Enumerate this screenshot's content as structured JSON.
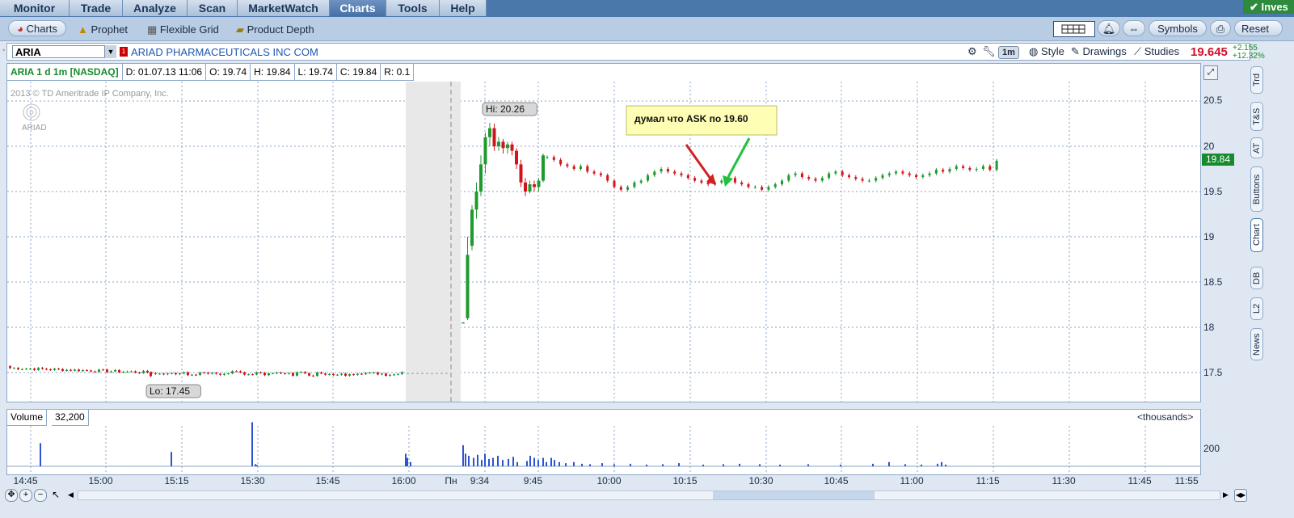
{
  "top_tabs": [
    {
      "label": "Monitor"
    },
    {
      "label": "Trade"
    },
    {
      "label": "Analyze"
    },
    {
      "label": "Scan"
    },
    {
      "label": "MarketWatch"
    },
    {
      "label": "Charts"
    },
    {
      "label": "Tools"
    },
    {
      "label": "Help"
    }
  ],
  "active_tab": "Charts",
  "invest_button": "Inves",
  "sub_toolbar": {
    "items": [
      {
        "label": "Charts",
        "icon": "charts-icon"
      },
      {
        "label": "Prophet",
        "icon": "prophet-icon"
      },
      {
        "label": "Flexible Grid",
        "icon": "grid-icon"
      },
      {
        "label": "Product Depth",
        "icon": "depth-icon"
      }
    ],
    "symbols_label": "Symbols",
    "reset_label": "Reset"
  },
  "symbol_bar": {
    "symbol": "ARIA",
    "flag": "1",
    "company_name": "ARIAD PHARMACEUTICALS INC COM",
    "aggregation": "1m",
    "style_label": "Style",
    "drawings_label": "Drawings",
    "studies_label": "Studies",
    "last_price": "19.645",
    "change_abs": "+2.155",
    "change_pct": "+12.32%"
  },
  "info_bar": {
    "title": "ARIA 1 d 1m [NASDAQ]",
    "date": "D: 01.07.13 11:06",
    "open": "O: 19.74",
    "high": "H: 19.84",
    "low": "L: 19.74",
    "close": "C: 19.84",
    "range": "R: 0.1"
  },
  "copyright": "2013 © TD Ameritrade IP Company, Inc.",
  "logo_text": "ARIAD",
  "annotations": {
    "hi_label": "Hi: 20.26",
    "lo_label": "Lo: 17.45",
    "note": "думал что ASK по 19.60"
  },
  "current_price_tag": "19.84",
  "y_axis_labels": [
    "20.5",
    "20",
    "19.5",
    "19",
    "18.5",
    "18",
    "17.5"
  ],
  "x_axis_labels": [
    "14:45",
    "15:00",
    "15:15",
    "15:30",
    "15:45",
    "16:00",
    "Пн",
    "9:34",
    "9:45",
    "10:00",
    "10:15",
    "10:30",
    "10:45",
    "11:00",
    "11:15",
    "11:30",
    "11:45",
    "11:55"
  ],
  "volume_panel": {
    "label": "Volume",
    "value": "32,200",
    "units": "<thousands>",
    "axis_label": "200"
  },
  "side_tabs": [
    "Trd",
    "T&S",
    "AT",
    "Buttons",
    "Chart",
    "DB",
    "L2",
    "News"
  ],
  "active_side_tab": "Chart",
  "colors": {
    "up": "#1f9a2e",
    "down": "#d3141d",
    "price_tag": "#178a2e",
    "note_bg": "#fefeb5"
  },
  "chart_data": {
    "type": "candlestick",
    "ylim": [
      17.2,
      20.7
    ],
    "series": [
      {
        "time": "premarket",
        "close": 17.55,
        "low": 17.45
      },
      {
        "time": "9:34",
        "close": 20.1,
        "high": 20.26
      },
      {
        "time": "9:45",
        "close": 19.55
      },
      {
        "time": "10:00",
        "close": 19.6
      },
      {
        "time": "10:15",
        "close": 19.55
      },
      {
        "time": "10:30",
        "close": 19.65
      },
      {
        "time": "10:45",
        "close": 19.65
      },
      {
        "time": "11:00",
        "close": 19.74
      },
      {
        "time": "11:06",
        "close": 19.84
      }
    ]
  }
}
